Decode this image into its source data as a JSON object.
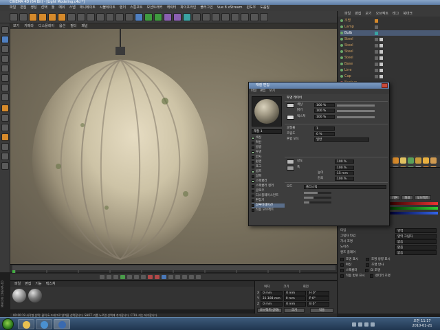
{
  "window": {
    "title": "CINEMA 4D (64 Bit) - [Light Modeling.c4d *]"
  },
  "menubar": {
    "items": [
      "파일",
      "편집",
      "생성",
      "선택",
      "툴",
      "메쉬",
      "스냅",
      "애니메이트",
      "시뮬레이트",
      "렌더",
      "스컬프트",
      "모션트래커",
      "캐릭터",
      "파이프라인",
      "플러그인",
      "Vue 8 xStream",
      "윈도우",
      "도움말"
    ]
  },
  "viewport": {
    "menu": [
      "보기",
      "카메라",
      "디스플레이",
      "옵션",
      "필터",
      "패널"
    ]
  },
  "timeline": {
    "ticks": [
      "0",
      "10",
      "20",
      "30",
      "40",
      "50",
      "60",
      "70",
      "80",
      "90"
    ]
  },
  "object_manager": {
    "menu": [
      "파일",
      "편집",
      "보기",
      "오브젝트",
      "태그",
      "북마크"
    ],
    "objects": [
      {
        "name": "조명"
      },
      {
        "name": "Lamp"
      },
      {
        "name": "Bulb"
      },
      {
        "name": "Steel"
      },
      {
        "name": "Steel"
      },
      {
        "name": "Steel"
      },
      {
        "name": "Steel"
      },
      {
        "name": "Base"
      },
      {
        "name": "Line"
      },
      {
        "name": "Cap"
      },
      {
        "name": "Backup"
      }
    ]
  },
  "material_manager": {
    "menu": [
      "파일",
      "편집",
      "기능",
      "텍스쳐"
    ]
  },
  "coordinates": {
    "headers": [
      "위치",
      "크기",
      "회전"
    ],
    "rows": [
      {
        "axis": "X",
        "pos": "0 mm",
        "size": "0 mm",
        "rot": "H 0°"
      },
      {
        "axis": "Y",
        "pos": "31.108 mm",
        "size": "0 mm",
        "rot": "P 0°"
      },
      {
        "axis": "Z",
        "pos": "0 mm",
        "size": "0 mm",
        "rot": "B 0°"
      }
    ],
    "mode_button": "오브젝트(상대)",
    "size_button": "크기",
    "apply_button": "적용"
  },
  "attributes": {
    "tabs": [
      "기본",
      "좌표",
      "오브젝트"
    ],
    "rows": [
      {
        "label": "타입",
        "value": "영역"
      },
      {
        "label": "그림자 타입",
        "value": "영역 그림자"
      },
      {
        "label": "가시 조명",
        "value": "없음"
      },
      {
        "label": "노이즈",
        "value": "없음"
      },
      {
        "label": "렌즈 플레어",
        "value": "없음"
      }
    ],
    "checks": [
      "조명 표시",
      "조명 방향 표시",
      "확산",
      "조명 반사",
      "스펙큘러",
      "GI 조명",
      "적용 범위 표시",
      "렌더러 조명"
    ]
  },
  "dialog": {
    "title": "재질 편집",
    "menu": [
      "파일",
      "편집",
      "보기"
    ],
    "material_name": "재질 1",
    "section_title": "투명 레이어",
    "channels": [
      {
        "label": "색상",
        "checked": true
      },
      {
        "label": "확산",
        "checked": false
      },
      {
        "label": "발광",
        "checked": false
      },
      {
        "label": "투명",
        "checked": true
      },
      {
        "label": "반사",
        "checked": false
      },
      {
        "label": "환경",
        "checked": false
      },
      {
        "label": "포그",
        "checked": false
      },
      {
        "label": "범프",
        "checked": true
      },
      {
        "label": "알파",
        "checked": false
      },
      {
        "label": "스펙큘러",
        "checked": true
      },
      {
        "label": "스펙큘러 컬러",
        "checked": false
      },
      {
        "label": "글로우",
        "checked": false
      },
      {
        "label": "디스플레이스먼트",
        "checked": false
      },
      {
        "label": "편집기",
        "checked": false
      },
      {
        "label": "일루미네이션",
        "checked": false
      },
      {
        "label": "적용 오브젝트",
        "checked": false
      }
    ],
    "fields": [
      {
        "label": "색상",
        "value": "100 %"
      },
      {
        "label": "밝기",
        "value": "100 %"
      },
      {
        "label": "텍스쳐",
        "value": "100 %"
      },
      {
        "label": "굴절률",
        "value": "1"
      },
      {
        "label": "흐림도",
        "value": "0 %"
      },
      {
        "label": "강도",
        "value": "100 %"
      },
      {
        "label": "폭",
        "value": "100 %"
      },
      {
        "label": "높이",
        "value": "15 mm"
      },
      {
        "label": "감쇠",
        "value": "100 %"
      },
      {
        "label": "모드",
        "value": "플라스틱"
      }
    ],
    "blend_label": "혼합 모드",
    "blend_value": "일반"
  },
  "statusbar": {
    "text": "00:00:19  사각형 선택: 클릭 & 드래그로 영역을 선택합니다. SHIFT 키를 누르면 선택에 추가합니다. CTRL 키는 제거합니다."
  },
  "taskbar": {
    "time": "오전 11:17",
    "date": "2010-01-21"
  },
  "brand": {
    "vertical": "MAXON CINEMA 4D"
  },
  "colors": {
    "accent": "#d68a2b",
    "window_title": "#5e7fa8"
  }
}
